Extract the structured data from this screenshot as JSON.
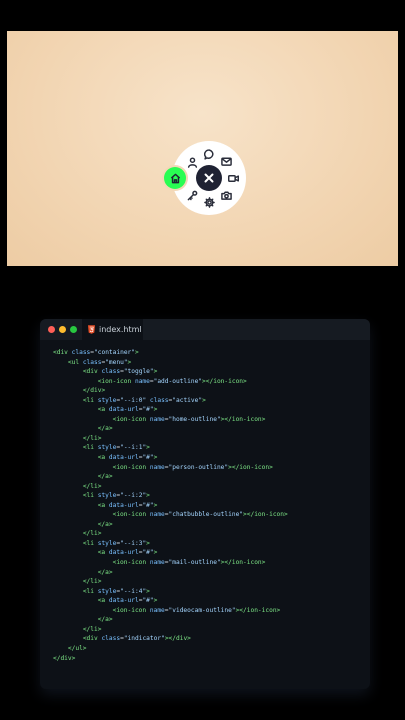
{
  "preview": {
    "background": "#f3d8b7",
    "menu": {
      "toggle_icon": "close-icon",
      "indicator_color": "#29fd53",
      "active_item": "home",
      "items": [
        {
          "name": "home",
          "icon": "home-outline"
        },
        {
          "name": "person",
          "icon": "person-outline"
        },
        {
          "name": "chatbubble",
          "icon": "chatbubble-outline"
        },
        {
          "name": "mail",
          "icon": "mail-outline"
        },
        {
          "name": "videocam",
          "icon": "videocam-outline"
        },
        {
          "name": "camera",
          "icon": "camera-outline"
        },
        {
          "name": "settings",
          "icon": "settings-outline"
        },
        {
          "name": "key",
          "icon": "key-outline"
        }
      ]
    }
  },
  "editor": {
    "tab_label": "index.html",
    "code_lines": [
      [
        [
          "t",
          "<div "
        ],
        [
          "a",
          "class"
        ],
        [
          "p",
          "="
        ],
        [
          "s",
          "\"container\""
        ],
        [
          "t",
          ">"
        ]
      ],
      [
        [
          "p",
          "    "
        ],
        [
          "t",
          "<ul "
        ],
        [
          "a",
          "class"
        ],
        [
          "p",
          "="
        ],
        [
          "s",
          "\"menu\""
        ],
        [
          "t",
          ">"
        ]
      ],
      [
        [
          "p",
          "        "
        ],
        [
          "t",
          "<div "
        ],
        [
          "a",
          "class"
        ],
        [
          "p",
          "="
        ],
        [
          "s",
          "\"toggle\""
        ],
        [
          "t",
          ">"
        ]
      ],
      [
        [
          "p",
          "            "
        ],
        [
          "t",
          "<ion-icon "
        ],
        [
          "a",
          "name"
        ],
        [
          "p",
          "="
        ],
        [
          "s",
          "\"add-outline\""
        ],
        [
          "t",
          "></ion-icon>"
        ]
      ],
      [
        [
          "p",
          "        "
        ],
        [
          "t",
          "</div>"
        ]
      ],
      [
        [
          "p",
          "        "
        ],
        [
          "t",
          "<li "
        ],
        [
          "a",
          "style"
        ],
        [
          "p",
          "="
        ],
        [
          "s",
          "\"--i:0\" "
        ],
        [
          "a",
          "class"
        ],
        [
          "p",
          "="
        ],
        [
          "s",
          "\"active\""
        ],
        [
          "t",
          ">"
        ]
      ],
      [
        [
          "p",
          "            "
        ],
        [
          "t",
          "<a "
        ],
        [
          "a",
          "data-url"
        ],
        [
          "p",
          "="
        ],
        [
          "s",
          "\"#\""
        ],
        [
          "t",
          ">"
        ]
      ],
      [
        [
          "p",
          "                "
        ],
        [
          "t",
          "<ion-icon "
        ],
        [
          "a",
          "name"
        ],
        [
          "p",
          "="
        ],
        [
          "s",
          "\"home-outline\""
        ],
        [
          "t",
          "></ion-icon>"
        ]
      ],
      [
        [
          "p",
          "            "
        ],
        [
          "t",
          "</a>"
        ]
      ],
      [
        [
          "p",
          "        "
        ],
        [
          "t",
          "</li>"
        ]
      ],
      [
        [
          "p",
          "        "
        ],
        [
          "t",
          "<li "
        ],
        [
          "a",
          "style"
        ],
        [
          "p",
          "="
        ],
        [
          "s",
          "\"--i:1\""
        ],
        [
          "t",
          ">"
        ]
      ],
      [
        [
          "p",
          "            "
        ],
        [
          "t",
          "<a "
        ],
        [
          "a",
          "data-url"
        ],
        [
          "p",
          "="
        ],
        [
          "s",
          "\"#\""
        ],
        [
          "t",
          ">"
        ]
      ],
      [
        [
          "p",
          "                "
        ],
        [
          "t",
          "<ion-icon "
        ],
        [
          "a",
          "name"
        ],
        [
          "p",
          "="
        ],
        [
          "s",
          "\"person-outline\""
        ],
        [
          "t",
          "></ion-icon>"
        ]
      ],
      [
        [
          "p",
          "            "
        ],
        [
          "t",
          "</a>"
        ]
      ],
      [
        [
          "p",
          "        "
        ],
        [
          "t",
          "</li>"
        ]
      ],
      [
        [
          "p",
          "        "
        ],
        [
          "t",
          "<li "
        ],
        [
          "a",
          "style"
        ],
        [
          "p",
          "="
        ],
        [
          "s",
          "\"--i:2\""
        ],
        [
          "t",
          ">"
        ]
      ],
      [
        [
          "p",
          "            "
        ],
        [
          "t",
          "<a "
        ],
        [
          "a",
          "data-url"
        ],
        [
          "p",
          "="
        ],
        [
          "s",
          "\"#\""
        ],
        [
          "t",
          ">"
        ]
      ],
      [
        [
          "p",
          "                "
        ],
        [
          "t",
          "<ion-icon "
        ],
        [
          "a",
          "name"
        ],
        [
          "p",
          "="
        ],
        [
          "s",
          "\"chatbubble-outline\""
        ],
        [
          "t",
          "></ion-icon>"
        ]
      ],
      [
        [
          "p",
          "            "
        ],
        [
          "t",
          "</a>"
        ]
      ],
      [
        [
          "p",
          "        "
        ],
        [
          "t",
          "</li>"
        ]
      ],
      [
        [
          "p",
          "        "
        ],
        [
          "t",
          "<li "
        ],
        [
          "a",
          "style"
        ],
        [
          "p",
          "="
        ],
        [
          "s",
          "\"--i:3\""
        ],
        [
          "t",
          ">"
        ]
      ],
      [
        [
          "p",
          "            "
        ],
        [
          "t",
          "<a "
        ],
        [
          "a",
          "data-url"
        ],
        [
          "p",
          "="
        ],
        [
          "s",
          "\"#\""
        ],
        [
          "t",
          ">"
        ]
      ],
      [
        [
          "p",
          "                "
        ],
        [
          "t",
          "<ion-icon "
        ],
        [
          "a",
          "name"
        ],
        [
          "p",
          "="
        ],
        [
          "s",
          "\"mail-outline\""
        ],
        [
          "t",
          "></ion-icon>"
        ]
      ],
      [
        [
          "p",
          "            "
        ],
        [
          "t",
          "</a>"
        ]
      ],
      [
        [
          "p",
          "        "
        ],
        [
          "t",
          "</li>"
        ]
      ],
      [
        [
          "p",
          "        "
        ],
        [
          "t",
          "<li "
        ],
        [
          "a",
          "style"
        ],
        [
          "p",
          "="
        ],
        [
          "s",
          "\"--i:4\""
        ],
        [
          "t",
          ">"
        ]
      ],
      [
        [
          "p",
          "            "
        ],
        [
          "t",
          "<a "
        ],
        [
          "a",
          "data-url"
        ],
        [
          "p",
          "="
        ],
        [
          "s",
          "\"#\""
        ],
        [
          "t",
          ">"
        ]
      ],
      [
        [
          "p",
          "                "
        ],
        [
          "t",
          "<ion-icon "
        ],
        [
          "a",
          "name"
        ],
        [
          "p",
          "="
        ],
        [
          "s",
          "\"videocam-outline\""
        ],
        [
          "t",
          "></ion-icon>"
        ]
      ],
      [
        [
          "p",
          "            "
        ],
        [
          "t",
          "</a>"
        ]
      ],
      [
        [
          "p",
          "        "
        ],
        [
          "t",
          "</li>"
        ]
      ],
      [
        [
          "p",
          "        "
        ],
        [
          "t",
          "<div "
        ],
        [
          "a",
          "class"
        ],
        [
          "p",
          "="
        ],
        [
          "s",
          "\"indicator\""
        ],
        [
          "t",
          "></div>"
        ]
      ],
      [
        [
          "p",
          "    "
        ],
        [
          "t",
          "</ul>"
        ]
      ],
      [
        [
          "t",
          "</div>"
        ]
      ]
    ]
  }
}
